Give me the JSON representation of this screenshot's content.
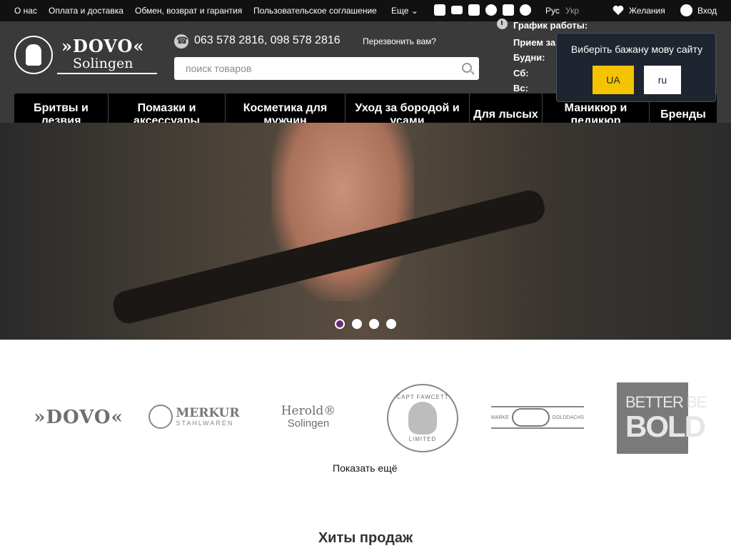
{
  "topbar": {
    "links": [
      "О нас",
      "Оплата и доставка",
      "Обмен, возврат и гарантия",
      "Пользовательское соглашение"
    ],
    "more_label": "Еще",
    "social_icons": [
      "facebook-icon",
      "youtube-icon",
      "instagram-icon",
      "telegram-icon",
      "viber-icon",
      "whatsapp-icon"
    ],
    "lang_ru": "Рус",
    "lang_ua": "Укр",
    "wishlist_label": "Желания",
    "login_label": "Вход"
  },
  "logo": {
    "brand": "»DOVO«",
    "sub": "Solingen"
  },
  "contacts": {
    "phones": "063 578 2816,    098 578 2816",
    "callback": "Перезвонить вам?"
  },
  "search": {
    "placeholder": "поиск товаров"
  },
  "schedule": {
    "title": "График работы:",
    "rows": [
      "Прием за",
      "Будни:",
      "Сб:",
      "Вс:"
    ]
  },
  "language_popup": {
    "message": "Виберіть бажану мову сайту",
    "ua_label": "UA",
    "ru_label": "ru",
    "ua_color": "#f5c400"
  },
  "categories": [
    "Бритвы и лезвия",
    "Помазки и аксессуары",
    "Косметика для мужчин",
    "Уход за бородой и усами",
    "Для лысых",
    "Маникюр и педикюр",
    "Бренды"
  ],
  "hero": {
    "slides_count": 4,
    "active_slide": 1,
    "active_dot_color": "#6b2c7a"
  },
  "brands": {
    "dovo": "»DOVO«",
    "merkur": "MERKUR",
    "merkur_sub": "STAHLWAREN",
    "herold": "Herold®",
    "herold_sub": "Solingen",
    "fawcett": "CAPT FAWCETT",
    "fawcett_sub": "LIMITED",
    "goldachs_left": "MARKE",
    "goldachs_right": "GOLDDACHS",
    "bold_top": "BETTER BE",
    "bold_bottom": "BOLD"
  },
  "show_more": "Показать ещё",
  "hits_title": "Хиты продаж"
}
